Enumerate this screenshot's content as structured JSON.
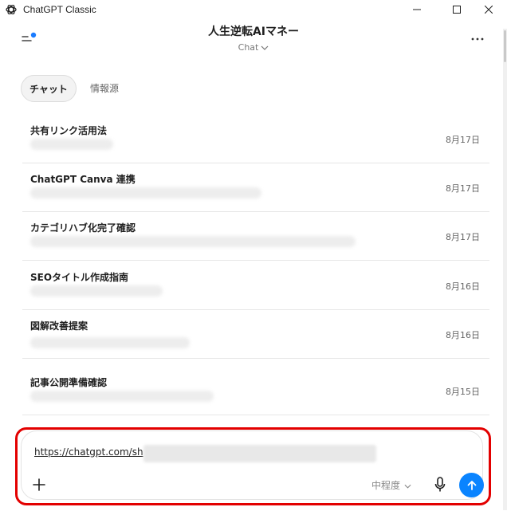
{
  "window": {
    "title": "ChatGPT Classic",
    "logo_icon": "openai-logo-icon",
    "controls": [
      "minimize-icon",
      "maximize-icon",
      "close-icon"
    ]
  },
  "header": {
    "menu_icon": "sidebar-menu-icon",
    "notification_dot_color": "#1a7cff",
    "conversation_title": "人生逆転AIマネー",
    "model_label": "Chat",
    "more_icon": "more-dots-icon"
  },
  "tabs": [
    {
      "label": "チャット",
      "active": true
    },
    {
      "label": "情報源",
      "active": false
    }
  ],
  "chats": [
    {
      "title": "共有リンク活用法",
      "date": "8月17日"
    },
    {
      "title": "ChatGPT Canva 連携",
      "date": "8月17日"
    },
    {
      "title": "カテゴリハブ化完了確認",
      "date": "8月17日"
    },
    {
      "title": "SEOタイトル作成指南",
      "date": "8月16日"
    },
    {
      "title": "図解改善提案",
      "date": "8月16日"
    },
    {
      "title": "記事公開準備確認",
      "date": "8月15日"
    }
  ],
  "composer": {
    "input_value": "https://chatgpt.com/sh",
    "add_icon": "plus-icon",
    "reasoning_effort": "中程度",
    "mic_icon": "microphone-icon",
    "send_icon": "arrow-up-icon",
    "accent_color": "#0a84ff",
    "highlight_color": "#e30000"
  }
}
